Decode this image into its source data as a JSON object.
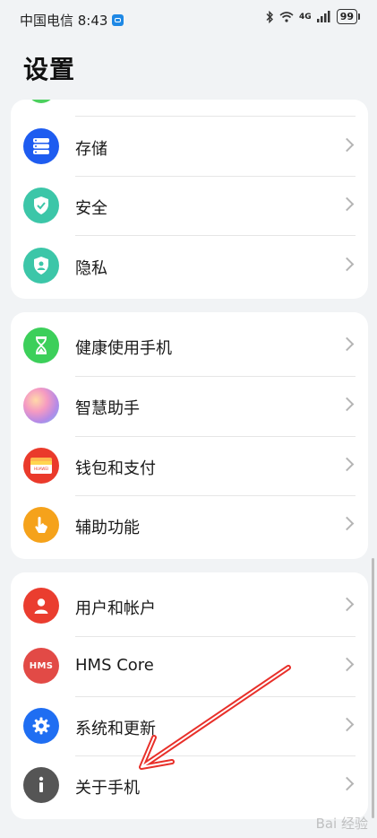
{
  "status_bar": {
    "carrier_time": "中国电信 8:43",
    "network": "4G",
    "battery": "99"
  },
  "page_title": "设置",
  "groups": [
    {
      "items": [
        {
          "label": "存储",
          "icon": "storage-icon",
          "color": "#1e5cf0"
        },
        {
          "label": "安全",
          "icon": "shield-check-icon",
          "color": "#3cc6a8"
        },
        {
          "label": "隐私",
          "icon": "privacy-icon",
          "color": "#3cc6a8"
        }
      ]
    },
    {
      "items": [
        {
          "label": "健康使用手机",
          "icon": "hourglass-icon",
          "color": "#3ccf5a"
        },
        {
          "label": "智慧助手",
          "icon": "assistant-orb-icon",
          "color": "#d98ae0"
        },
        {
          "label": "钱包和支付",
          "icon": "wallet-icon",
          "color": "#ea3a2b"
        },
        {
          "label": "辅助功能",
          "icon": "accessibility-hand-icon",
          "color": "#f5a21b"
        }
      ]
    },
    {
      "items": [
        {
          "label": "用户和帐户",
          "icon": "user-icon",
          "color": "#ea3d2f"
        },
        {
          "label": "HMS Core",
          "icon": "hms-icon",
          "color": "#e24a46",
          "icon_text": "HMS"
        },
        {
          "label": "系统和更新",
          "icon": "gear-icon",
          "color": "#1f6ef2"
        },
        {
          "label": "关于手机",
          "icon": "info-icon",
          "color": "#555555"
        }
      ]
    }
  ],
  "wallet_icon_text": "HUAWEI",
  "watermark": "Bai 经验"
}
